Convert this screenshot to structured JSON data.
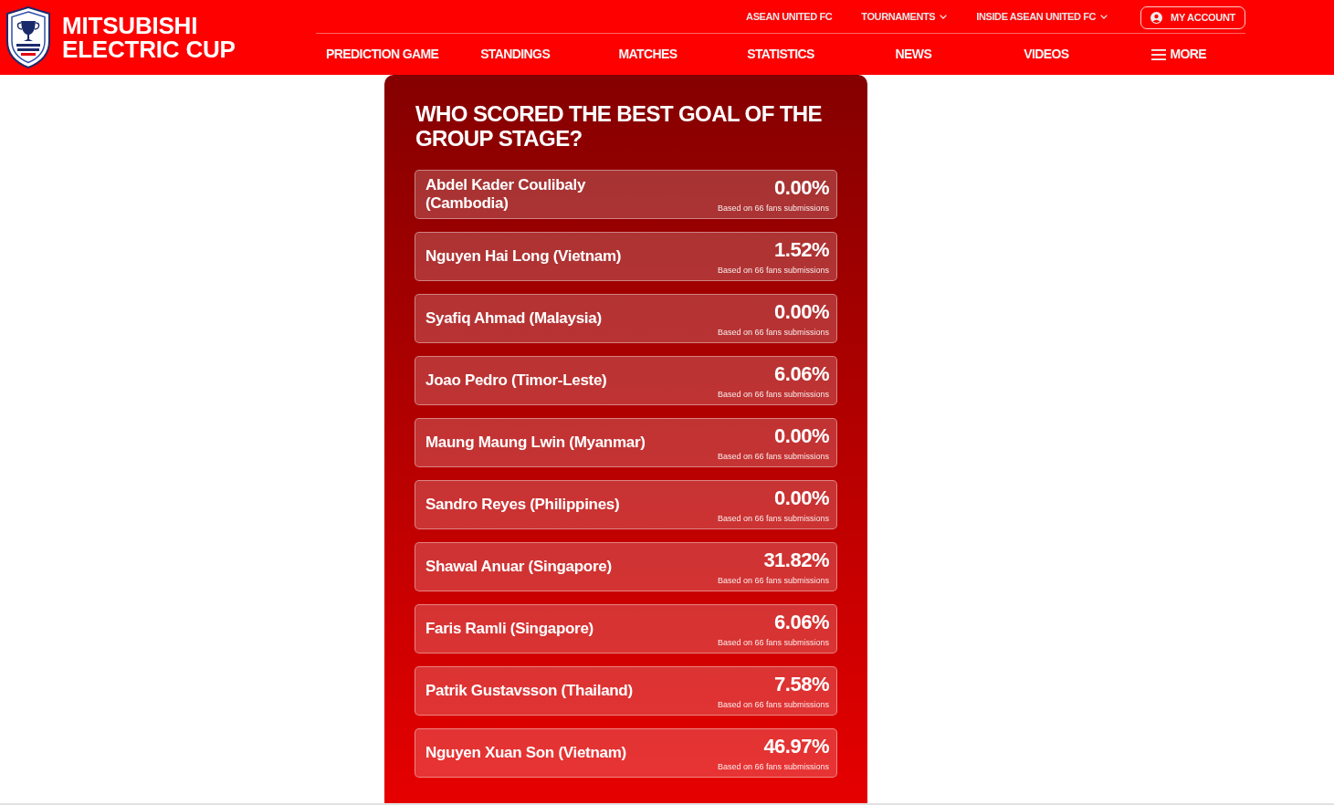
{
  "header": {
    "brand": "MITSUBISHI ELECTRIC CUP",
    "top_links": [
      {
        "label": "ASEAN UNITED FC",
        "dropdown": false
      },
      {
        "label": "TOURNAMENTS",
        "dropdown": true
      },
      {
        "label": "INSIDE ASEAN UNITED FC",
        "dropdown": true
      }
    ],
    "account_button": {
      "label": "MY ACCOUNT"
    },
    "main_nav": [
      {
        "label": "PREDICTION GAME",
        "kind": "link"
      },
      {
        "label": "STANDINGS",
        "kind": "link"
      },
      {
        "label": "MATCHES",
        "kind": "link"
      },
      {
        "label": "STATISTICS",
        "kind": "link"
      },
      {
        "label": "NEWS",
        "kind": "link"
      },
      {
        "label": "VIDEOS",
        "kind": "link"
      },
      {
        "label": "MORE",
        "kind": "menu"
      }
    ]
  },
  "poll": {
    "question": "WHO SCORED THE BEST GOAL OF THE GROUP STAGE?",
    "options": [
      {
        "name": "Abdel Kader Coulibaly (Cambodia)",
        "percentage": "0.00%",
        "note": "Based on 66 fans submissions"
      },
      {
        "name": "Nguyen Hai Long (Vietnam)",
        "percentage": "1.52%",
        "note": "Based on 66 fans submissions"
      },
      {
        "name": "Syafiq Ahmad (Malaysia)",
        "percentage": "0.00%",
        "note": "Based on 66 fans submissions"
      },
      {
        "name": "Joao Pedro (Timor-Leste)",
        "percentage": "6.06%",
        "note": "Based on 66 fans submissions"
      },
      {
        "name": "Maung Maung Lwin (Myanmar)",
        "percentage": "0.00%",
        "note": "Based on 66 fans submissions"
      },
      {
        "name": "Sandro Reyes (Philippines)",
        "percentage": "0.00%",
        "note": "Based on 66 fans submissions"
      },
      {
        "name": "Shawal Anuar (Singapore)",
        "percentage": "31.82%",
        "note": "Based on 66 fans submissions"
      },
      {
        "name": "Faris Ramli (Singapore)",
        "percentage": "6.06%",
        "note": "Based on 66 fans submissions"
      },
      {
        "name": "Patrik Gustavsson (Thailand)",
        "percentage": "7.58%",
        "note": "Based on 66 fans submissions"
      },
      {
        "name": "Nguyen Xuan Son (Vietnam)",
        "percentage": "46.97%",
        "note": "Based on 66 fans submissions"
      }
    ]
  }
}
